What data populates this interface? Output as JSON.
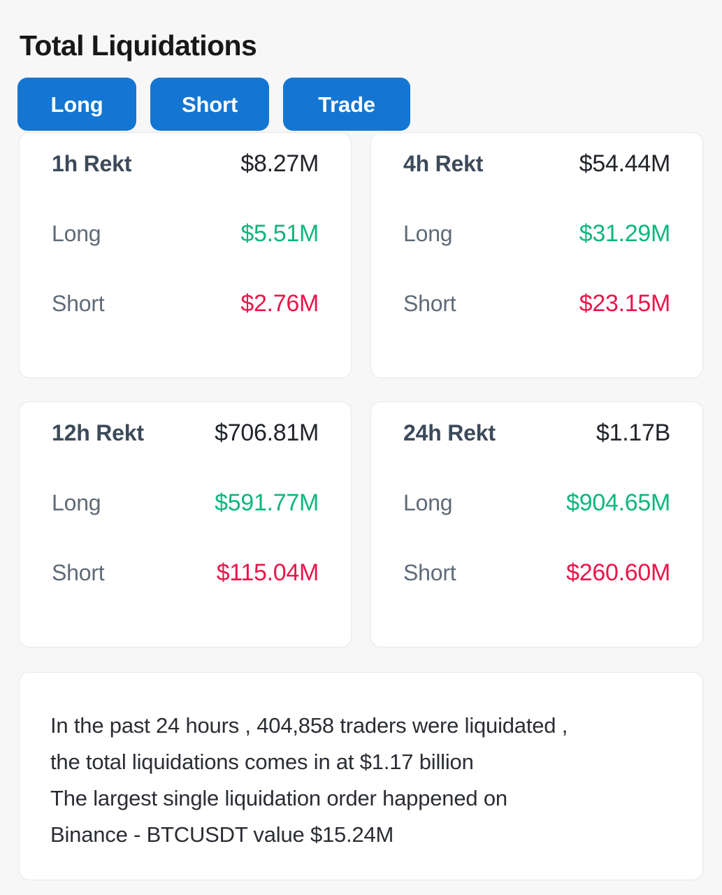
{
  "header": {
    "title": "Total Liquidations"
  },
  "tabs": [
    {
      "label": "Long",
      "name": "tab-long"
    },
    {
      "label": "Short",
      "name": "tab-short"
    },
    {
      "label": "Trade",
      "name": "tab-trade"
    }
  ],
  "row_labels": {
    "long": "Long",
    "short": "Short"
  },
  "cards": [
    {
      "period_label": "1h Rekt",
      "total": "$8.27M",
      "long_label": "Long",
      "long_value": "$5.51M",
      "short_label": "Short",
      "short_value": "$2.76M"
    },
    {
      "period_label": "4h Rekt",
      "total": "$54.44M",
      "long_label": "Long",
      "long_value": "$31.29M",
      "short_label": "Short",
      "short_value": "$23.15M"
    },
    {
      "period_label": "12h Rekt",
      "total": "$706.81M",
      "long_label": "Long",
      "long_value": "$591.77M",
      "short_label": "Short",
      "short_value": "$115.04M"
    },
    {
      "period_label": "24h Rekt",
      "total": "$1.17B",
      "long_label": "Long",
      "long_value": "$904.65M",
      "short_label": "Short",
      "short_value": "$260.60M"
    }
  ],
  "summary": {
    "line1": "In the past 24 hours , 404,858 traders were liquidated ,",
    "line2": "the total liquidations comes in at $1.17 billion",
    "line3": "The largest single liquidation order happened on",
    "line4": "Binance - BTCUSDT value $15.24M"
  },
  "colors": {
    "background": "#f7f7f8",
    "card": "#ffffff",
    "card_border": "#e7e7ea",
    "accent_blue": "#1476d2",
    "long_green": "#0fb67f",
    "short_red": "#e8164a",
    "title": "#17181a",
    "label_head": "#3c4a5a",
    "label_muted": "#5f6b78"
  }
}
